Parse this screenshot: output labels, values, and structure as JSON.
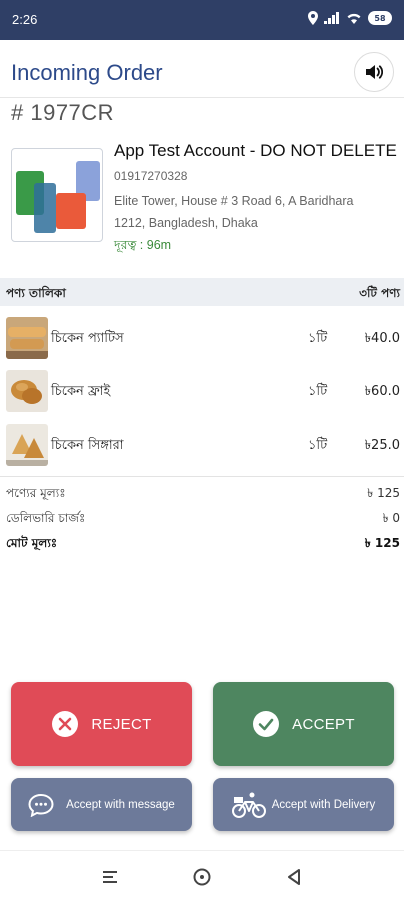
{
  "status_bar": {
    "time": "2:26",
    "battery": "58"
  },
  "header": {
    "title": "Incoming Order"
  },
  "order": {
    "id": "# 1977CR"
  },
  "customer": {
    "name": "App Test Account - DO NOT DELETE",
    "phone": "01917270328",
    "address_line1": "Elite Tower, House # 3 Road 6, A Baridhara",
    "address_line2": "1212, Bangladesh, Dhaka",
    "distance": "দূরত্ব : 96m"
  },
  "items_header": {
    "label": "পণ্য তালিকা",
    "count": "৩টি পণ্য"
  },
  "items": [
    {
      "name": "চিকেন প্যাটিস",
      "qty": "১টি",
      "price": "৳40.0"
    },
    {
      "name": "চিকেন ফ্রাই",
      "qty": "১টি",
      "price": "৳60.0"
    },
    {
      "name": "চিকেন সিঙ্গারা",
      "qty": "১টি",
      "price": "৳25.0"
    }
  ],
  "summary": {
    "subtotal_label": "পণ্যের মূল্যঃ",
    "subtotal": "৳ 125",
    "delivery_label": "ডেলিভারি চার্জঃ",
    "delivery": "৳ 0",
    "total_label": "মোট মূল্যঃ",
    "total": "৳ 125"
  },
  "actions": {
    "reject": "REJECT",
    "accept": "ACCEPT",
    "accept_message": "Accept with message",
    "accept_delivery": "Accept with Delivery"
  },
  "colors": {
    "status_bar": "#2f3f66",
    "title": "#2d4a8a",
    "reject": "#e04b57",
    "accept": "#4e8660",
    "secondary": "#6d7a9a",
    "distance": "#3a8a3a"
  },
  "icons": {
    "sound": "speaker-icon",
    "reject": "close-circle-icon",
    "accept": "check-circle-icon",
    "message": "chat-bubble-icon",
    "delivery": "bicycle-icon",
    "nav_recent": "menu-lines-icon",
    "nav_home": "circle-icon",
    "nav_back": "triangle-back-icon"
  }
}
